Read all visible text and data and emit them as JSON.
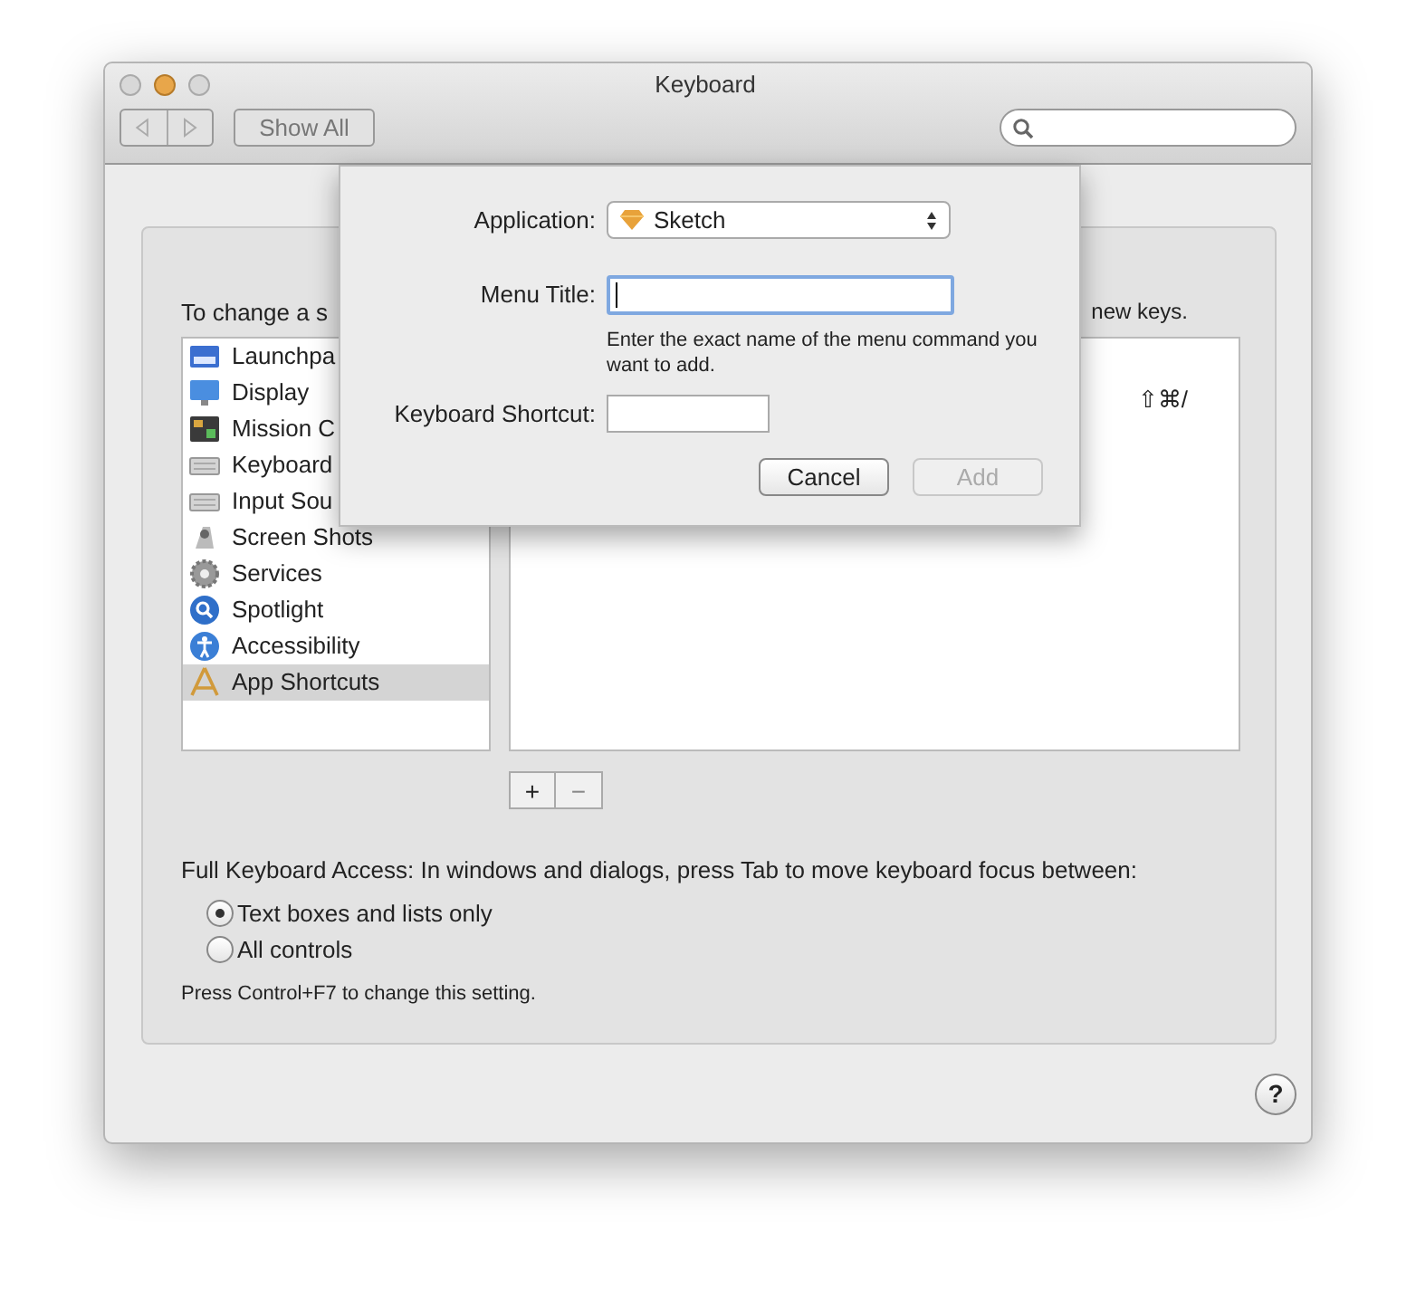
{
  "window": {
    "title": "Keyboard"
  },
  "toolbar": {
    "show_all": "Show All"
  },
  "instruction": {
    "start": "To change a s",
    "end": "new keys."
  },
  "sidebar": {
    "items": [
      {
        "label": "Launchpa",
        "selected": false
      },
      {
        "label": "Display",
        "selected": false
      },
      {
        "label": "Mission C",
        "selected": false
      },
      {
        "label": "Keyboard",
        "selected": false
      },
      {
        "label": "Input Sou",
        "selected": false
      },
      {
        "label": "Screen Shots",
        "selected": false
      },
      {
        "label": "Services",
        "selected": false
      },
      {
        "label": "Spotlight",
        "selected": false
      },
      {
        "label": "Accessibility",
        "selected": false
      },
      {
        "label": "App Shortcuts",
        "selected": true
      }
    ]
  },
  "shortcuts_pane": {
    "shortcut": "⇧⌘/"
  },
  "list_buttons": [
    "+",
    "−"
  ],
  "full_keyboard_access": {
    "label": "Full Keyboard Access: In windows and dialogs, press Tab to move keyboard focus between:",
    "options": [
      {
        "label": "Text boxes and lists only",
        "selected": true
      },
      {
        "label": "All controls",
        "selected": false
      }
    ],
    "note": "Press Control+F7 to change this setting."
  },
  "help": "?",
  "sheet": {
    "application_label": "Application:",
    "application_value": "Sketch",
    "menu_title_label": "Menu Title:",
    "menu_title_hint": "Enter the exact name of the menu command you want to add.",
    "shortcut_label": "Keyboard Shortcut:",
    "cancel": "Cancel",
    "add": {
      "label": "Add",
      "disabled": true
    }
  }
}
